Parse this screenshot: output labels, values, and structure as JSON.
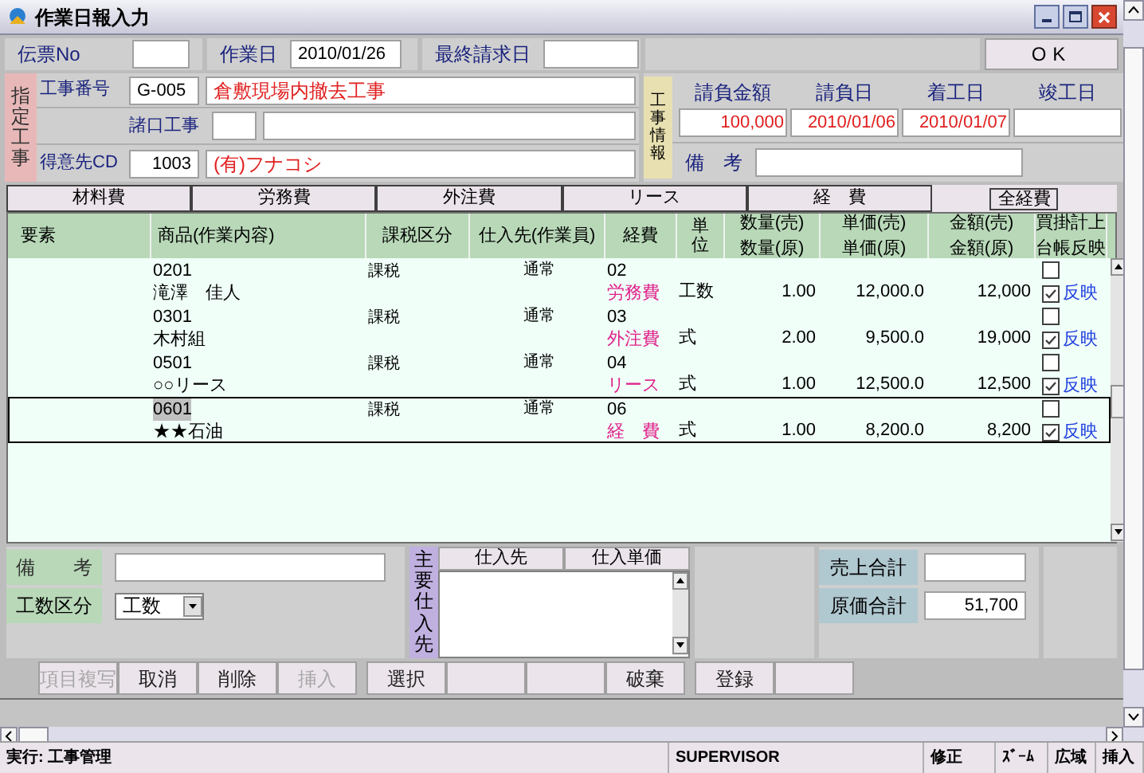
{
  "window": {
    "title": "作業日報入力"
  },
  "top_fields": [
    {
      "label": "伝票No"
    },
    {
      "label": "作業日",
      "value": "2010/01/26"
    },
    {
      "label": "最終請求日"
    }
  ],
  "ok_button": "OK",
  "designated_work": {
    "label": "指定工事",
    "work_no": {
      "label": "工事番号",
      "code": "G-005",
      "name": "倉敷現場内撤去工事"
    },
    "misc_work": {
      "label": "諸口工事"
    },
    "customer": {
      "label": "得意先CD",
      "code": "1003",
      "name": "(有)フナコシ"
    }
  },
  "work_info": {
    "label": "工事情報",
    "columns": [
      {
        "label": "請負金額",
        "value": "100,000"
      },
      {
        "label": "請負日",
        "value": "2010/01/06"
      },
      {
        "label": "着工日",
        "value": "2010/01/07"
      },
      {
        "label": "竣工日"
      }
    ],
    "remarks_label": "備　考"
  },
  "tabs": [
    {
      "label": "材料費",
      "selected": false
    },
    {
      "label": "労務費",
      "selected": false
    },
    {
      "label": "外注費",
      "selected": false
    },
    {
      "label": "リース",
      "selected": false
    },
    {
      "label": "経　費",
      "selected": false
    },
    {
      "label": "全経費",
      "selected": true
    }
  ],
  "table": {
    "columns": [
      {
        "label": "要素"
      },
      {
        "label": "商品(作業内容)"
      },
      {
        "label": "課税区分"
      },
      {
        "label": "仕入先(作業員)"
      },
      {
        "label": "経費"
      },
      {
        "label": "単位"
      },
      {
        "label": "数量(売)",
        "label2": "数量(原)"
      },
      {
        "label": "単価(売)",
        "label2": "単価(原)"
      },
      {
        "label": "金額(売)",
        "label2": "金額(原)"
      },
      {
        "label": "買掛計上",
        "label2": "台帳反映"
      }
    ],
    "rows": [
      {
        "item_code": "0201",
        "item_name": "滝澤　佳人",
        "tax": "課税",
        "supplier": "通常",
        "expense_code": "02",
        "expense": "労務費",
        "unit": "工数",
        "qty": "1.00",
        "price": "12,000.0",
        "amount": "12,000",
        "payable": false,
        "ledger": true,
        "ledger_label": "反映",
        "selected": false
      },
      {
        "item_code": "0301",
        "item_name": "木村組",
        "tax": "課税",
        "supplier": "通常",
        "expense_code": "03",
        "expense": "外注費",
        "unit": "式",
        "qty": "2.00",
        "price": "9,500.0",
        "amount": "19,000",
        "payable": false,
        "ledger": true,
        "ledger_label": "反映",
        "selected": false
      },
      {
        "item_code": "0501",
        "item_name": "○○リース",
        "tax": "課税",
        "supplier": "通常",
        "expense_code": "04",
        "expense": "リース",
        "unit": "式",
        "qty": "1.00",
        "price": "12,500.0",
        "amount": "12,500",
        "payable": false,
        "ledger": true,
        "ledger_label": "反映",
        "selected": false
      },
      {
        "item_code": "0601",
        "item_name": "★★石油",
        "tax": "課税",
        "supplier": "通常",
        "expense_code": "06",
        "expense": "経　費",
        "unit": "式",
        "qty": "1.00",
        "price": "8,200.0",
        "amount": "8,200",
        "payable": false,
        "ledger": true,
        "ledger_label": "反映",
        "selected": true
      }
    ]
  },
  "detail": {
    "remarks_label": "備　　考",
    "labor_type": {
      "label": "工数区分",
      "value": "工数"
    },
    "main_supplier": {
      "label": "主要仕入先",
      "columns": [
        "仕入先",
        "仕入単価"
      ]
    },
    "totals": [
      {
        "label": "売上合計"
      },
      {
        "label": "原価合計",
        "value": "51,700"
      }
    ]
  },
  "button_groups": [
    [
      {
        "kind": "button",
        "label": "項目複写",
        "disabled": true
      },
      {
        "kind": "button",
        "label": "取消",
        "disabled": false
      },
      {
        "kind": "button",
        "label": "削除",
        "disabled": false
      },
      {
        "kind": "button",
        "label": "挿入",
        "disabled": true
      }
    ],
    [
      {
        "kind": "button",
        "label": "選択",
        "disabled": false
      },
      {
        "kind": "blank"
      },
      {
        "kind": "blank"
      },
      {
        "kind": "button",
        "label": "破棄",
        "disabled": false
      }
    ],
    [
      {
        "kind": "button",
        "label": "登録",
        "disabled": false
      },
      {
        "kind": "blank"
      }
    ]
  ],
  "status_bar": [
    "実行: 工事管理",
    "SUPERVISOR",
    "修正",
    "ｽﾞｰﾑ",
    "広域",
    "挿入"
  ]
}
